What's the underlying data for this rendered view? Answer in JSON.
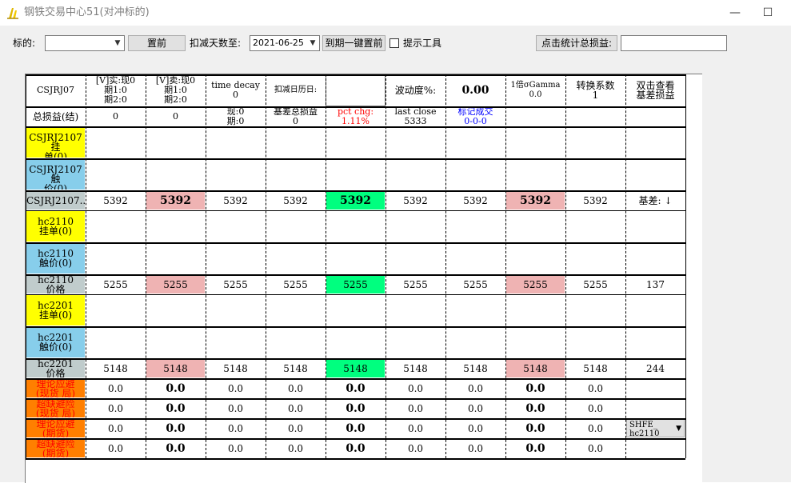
{
  "window": {
    "title": "钢铁交易中心51(对冲标的)",
    "minimize_glyph": "—",
    "maximize_glyph": "☐"
  },
  "toolbar": {
    "underlying_label": "标的:",
    "underlying_value": "",
    "reset_label": "置前",
    "days_label": "扣减天数至:",
    "date_value": "2021-06-25",
    "one_click_label": "到期一键置前",
    "tip_tool_label": "提示工具",
    "tip_tool_checked": false,
    "stats_button_label": "点击统计总损益:",
    "stats_value": ""
  },
  "table": {
    "header": [
      "CSJRJ07",
      "[V]实:现0\n期1:0\n期2:0",
      "[V]卖:现0\n期1:0\n期2:0",
      "time decay\n0",
      "扣减日历日:",
      "",
      "波动度%:",
      "0.00",
      "1倍σGamma\n0.0",
      "转换系数\n1",
      "双击查看\n基差损益"
    ],
    "summary": [
      "总损益(结)",
      "0",
      "0",
      "现:0\n期:0",
      "基差总损益\n0",
      "pct chg:\n1.11%",
      "last close\n5333",
      "标记成交\n0-0-0",
      "",
      "",
      ""
    ],
    "rows": [
      {
        "label": "CSJRJ2107挂\n单(0)",
        "cells": [
          "",
          "",
          "",
          "",
          "",
          "",
          "",
          "",
          "",
          ""
        ]
      },
      {
        "label": "CSJRJ2107触\n价(0)",
        "cells": [
          "",
          "",
          "",
          "",
          "",
          "",
          "",
          "",
          "",
          ""
        ]
      },
      {
        "label": "CSJRJ2107...",
        "cells": [
          "5392",
          "5392",
          "5392",
          "5392",
          "5392",
          "5392",
          "5392",
          "5392",
          "5392",
          "基差: ↓"
        ]
      },
      {
        "label": "hc2110\n挂单(0)",
        "cells": [
          "",
          "",
          "",
          "",
          "",
          "",
          "",
          "",
          "",
          ""
        ]
      },
      {
        "label": "hc2110\n触价(0)",
        "cells": [
          "",
          "",
          "",
          "",
          "",
          "",
          "",
          "",
          "",
          ""
        ]
      },
      {
        "label": "hc2110\n价格",
        "cells": [
          "5255",
          "5255",
          "5255",
          "5255",
          "5255",
          "5255",
          "5255",
          "5255",
          "5255",
          "137"
        ]
      },
      {
        "label": "hc2201\n挂单(0)",
        "cells": [
          "",
          "",
          "",
          "",
          "",
          "",
          "",
          "",
          "",
          ""
        ]
      },
      {
        "label": "hc2201\n触价(0)",
        "cells": [
          "",
          "",
          "",
          "",
          "",
          "",
          "",
          "",
          "",
          ""
        ]
      },
      {
        "label": "hc2201\n价格",
        "cells": [
          "5148",
          "5148",
          "5148",
          "5148",
          "5148",
          "5148",
          "5148",
          "5148",
          "5148",
          "244"
        ]
      },
      {
        "label": "理论应避\n(现货 局)",
        "cells": [
          "0.0",
          "0.0",
          "0.0",
          "0.0",
          "0.0",
          "0.0",
          "0.0",
          "0.0",
          "0.0",
          ""
        ]
      },
      {
        "label": "超缺避险\n(现货 局)",
        "cells": [
          "0.0",
          "0.0",
          "0.0",
          "0.0",
          "0.0",
          "0.0",
          "0.0",
          "0.0",
          "0.0",
          ""
        ]
      },
      {
        "label": "理论应避\n(期货)",
        "cells": [
          "0.0",
          "0.0",
          "0.0",
          "0.0",
          "0.0",
          "0.0",
          "0.0",
          "0.0",
          "0.0",
          "SHFE_\nhc2110"
        ]
      },
      {
        "label": "超缺避险\n(期货)",
        "cells": [
          "0.0",
          "0.0",
          "0.0",
          "0.0",
          "0.0",
          "0.0",
          "0.0",
          "0.0",
          "0.0",
          ""
        ]
      }
    ]
  },
  "colors": {
    "pending_order": "#ffff00",
    "trigger_price": "#87ceeb",
    "price_row": "#c0cccc",
    "bid_ask": "#efb3b3",
    "last_price": "#00ff7f",
    "hedge": "#ff7f00",
    "pct_chg": "#ff0000",
    "marked_trade": "#0000ff",
    "hedge_text": "#ff0000"
  }
}
